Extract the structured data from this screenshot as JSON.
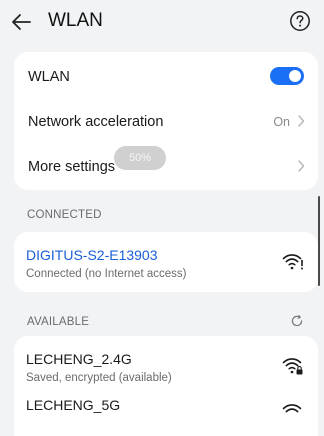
{
  "header": {
    "title": "WLAN",
    "back_icon": "arrow-left-icon",
    "help_icon": "question-circle-icon"
  },
  "settings": {
    "wlan": {
      "label": "WLAN",
      "enabled": true
    },
    "network_acceleration": {
      "label": "Network acceleration",
      "value": "On"
    },
    "more_settings": {
      "label": "More settings"
    }
  },
  "zoom_indicator": "50%",
  "connected": {
    "section_label": "CONNECTED",
    "network": {
      "name": "DIGITUS-S2-E13903",
      "status": "Connected (no Internet access)",
      "signal_icon": "wifi-no-internet-icon"
    }
  },
  "available": {
    "section_label": "AVAILABLE",
    "refresh_icon": "refresh-icon",
    "networks": [
      {
        "name": "LECHENG_2.4G",
        "status": "Saved, encrypted (available)",
        "signal_icon": "wifi-lock-icon"
      },
      {
        "name": "LECHENG_5G",
        "status": "",
        "signal_icon": "wifi-icon"
      }
    ]
  },
  "colors": {
    "accent": "#1a6ff5",
    "connected_name": "#1a5fd6",
    "background": "#f1f3f5",
    "card": "#ffffff"
  }
}
